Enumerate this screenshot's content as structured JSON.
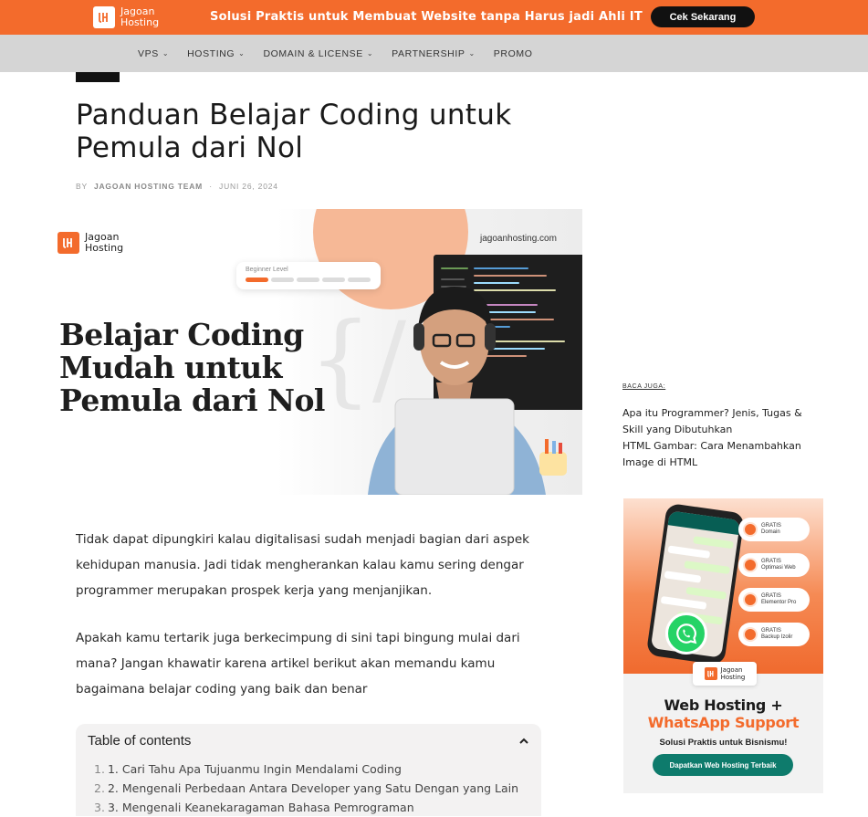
{
  "promo": {
    "logo_line1": "Jagoan",
    "logo_line2": "Hosting",
    "message": "Solusi Praktis untuk Membuat Website tanpa Harus jadi Ahli IT",
    "cta": "Cek Sekarang",
    "brand_color": "#f36b2c"
  },
  "nav": {
    "items": [
      {
        "label": "VPS",
        "dropdown": true
      },
      {
        "label": "HOSTING",
        "dropdown": true
      },
      {
        "label": "DOMAIN & LICENSE",
        "dropdown": true
      },
      {
        "label": "PARTNERSHIP",
        "dropdown": true
      },
      {
        "label": "PROMO",
        "dropdown": false
      }
    ]
  },
  "article": {
    "title_line1": "Panduan Belajar Coding untuk",
    "title_line2": "Pemula dari Nol",
    "by": "BY",
    "author": "JAGOAN HOSTING TEAM",
    "separator": "·",
    "date": "JUNI 26, 2024",
    "paragraph1": "Tidak dapat dipungkiri kalau digitalisasi sudah menjadi bagian dari aspek kehidupan manusia. Jadi tidak mengherankan kalau kamu sering dengar programmer merupakan prospek kerja yang menjanjikan.",
    "paragraph2": "Apakah kamu tertarik juga berkecimpung di sini tapi bingung mulai dari mana? Jangan khawatir karena artikel berikut akan memandu kamu bagaimana belajar coding yang baik dan benar"
  },
  "hero": {
    "logo_line1": "Jagoan",
    "logo_line2": "Hosting",
    "site": "jagoanhosting.com",
    "level_label": "Beginner Level",
    "level_value": 0.2,
    "headline_line1": "Belajar Coding",
    "headline_line2": "Mudah untuk",
    "headline_line3": "Pemula dari Nol",
    "brace": "{/"
  },
  "toc": {
    "title": "Table of contents",
    "items": [
      {
        "num": "1.",
        "label": "1. Cari Tahu Apa Tujuanmu Ingin Mendalami Coding"
      },
      {
        "num": "2.",
        "label": "2. Mengenali Perbedaan Antara Developer yang Satu Dengan yang Lain"
      },
      {
        "num": "3.",
        "label": "3. Mengenali Keanekaragaman Bahasa Pemrograman"
      }
    ]
  },
  "sidebar": {
    "baca_juga": "BACA JUGA:",
    "link1": "Apa itu Programmer? Jenis, Tugas & Skill yang Dibutuhkan",
    "link2": "HTML Gambar: Cara Menambahkan Image di HTML"
  },
  "ad": {
    "badges": [
      {
        "line1": "GRATIS",
        "line2": "Domain"
      },
      {
        "line1": "GRATIS",
        "line2": "Optimasi Web"
      },
      {
        "line1": "GRATIS",
        "line2": "Elementor Pro"
      },
      {
        "line1": "GRATIS",
        "line2": "Backup Izolir"
      }
    ],
    "logo_line1": "Jagoan",
    "logo_line2": "Hosting",
    "headline1": "Web Hosting +",
    "headline2": "WhatsApp Support",
    "subline": "Solusi Praktis untuk Bisnismu!",
    "button": "Dapatkan Web Hosting Terbaik",
    "whatsapp_color": "#25d366"
  }
}
